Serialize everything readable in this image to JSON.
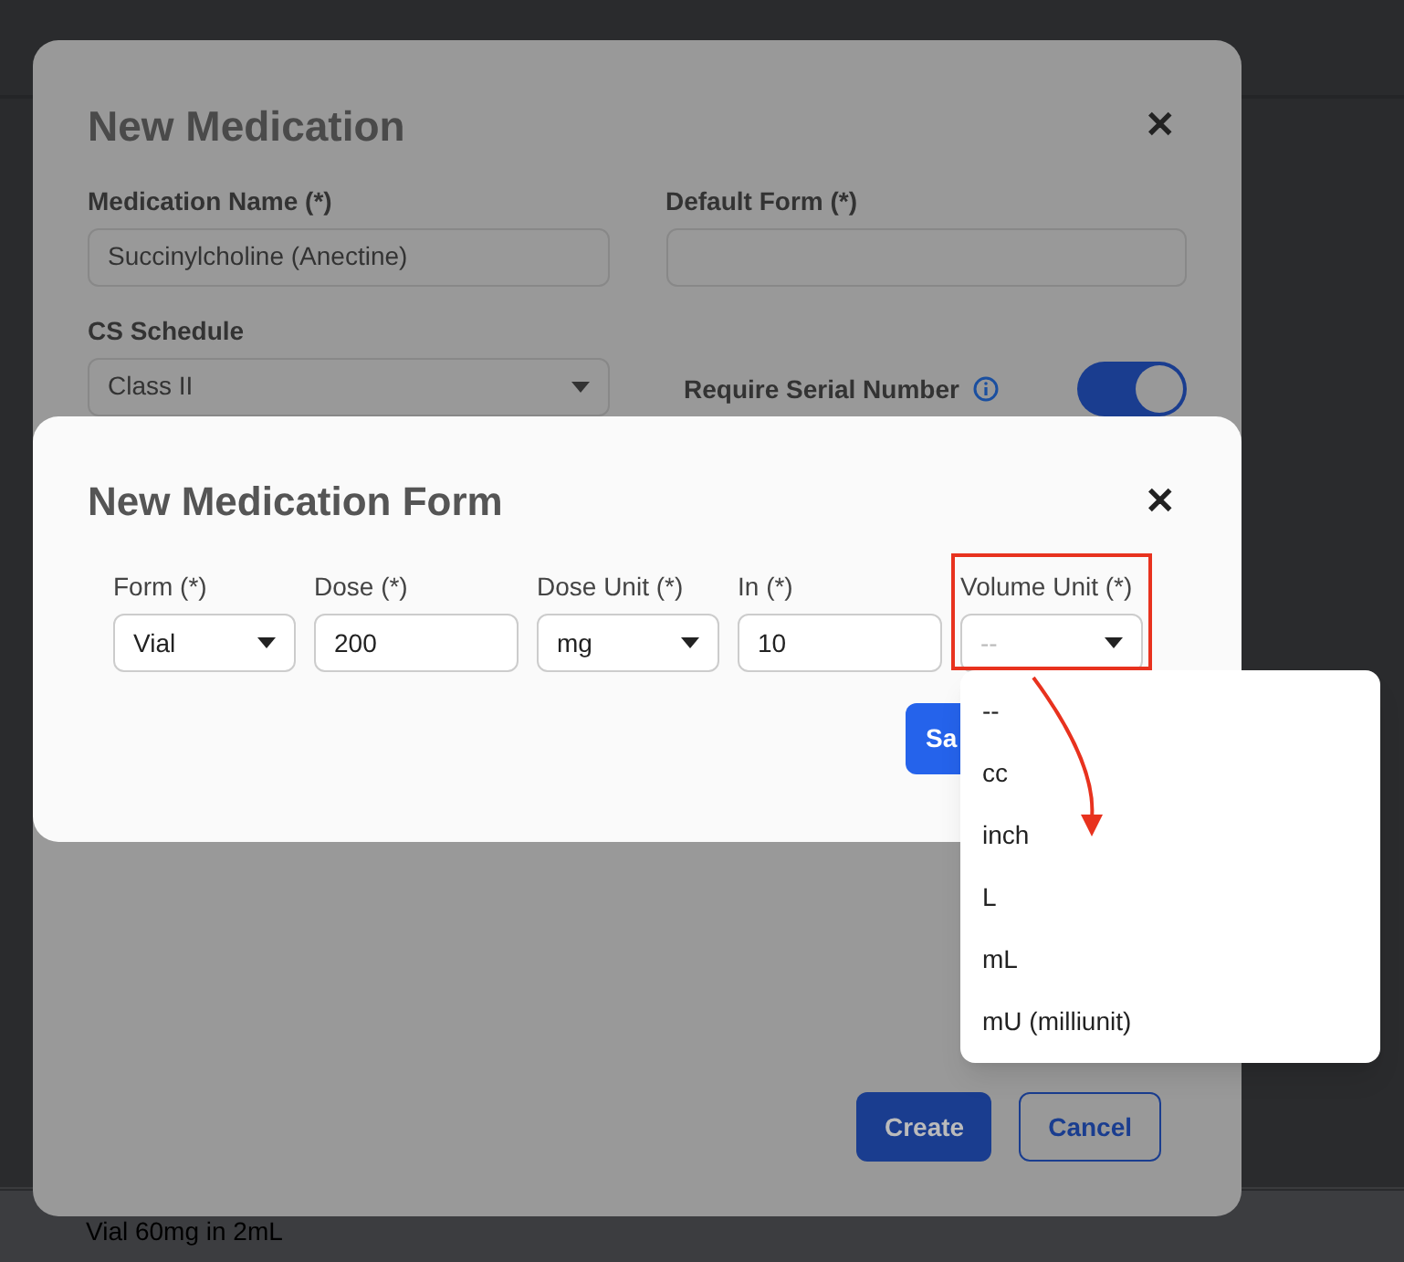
{
  "background": {
    "row_text": "Vial 60mg in 2mL"
  },
  "medication_dialog": {
    "title": "New Medication",
    "close": "✕",
    "medication_name": {
      "label": "Medication Name (*)",
      "value": "Succinylcholine (Anectine)"
    },
    "default_form": {
      "label": "Default Form (*)"
    },
    "cs_schedule": {
      "label": "CS Schedule",
      "value": "Class II"
    },
    "require_serial_number": {
      "label": "Require Serial Number",
      "on": true
    },
    "buttons": [
      {
        "label": "Create",
        "kind": "primary"
      },
      {
        "label": "Cancel",
        "kind": "secondary"
      }
    ]
  },
  "form_dialog": {
    "title": "New Medication Form",
    "close": "✕",
    "fields": [
      {
        "label": "Form (*)",
        "kind": "select",
        "value": "Vial"
      },
      {
        "label": "Dose (*)",
        "kind": "text",
        "value": "200"
      },
      {
        "label": "Dose Unit (*)",
        "kind": "select",
        "value": "mg"
      },
      {
        "label": "In (*)",
        "kind": "text",
        "value": "10"
      },
      {
        "label": "Volume Unit (*)",
        "kind": "select",
        "placeholder": "--"
      }
    ],
    "save_button": "Sa"
  },
  "dropdown": {
    "options": [
      "--",
      "cc",
      "inch",
      "L",
      "mL",
      "mU (milliunit)"
    ]
  }
}
